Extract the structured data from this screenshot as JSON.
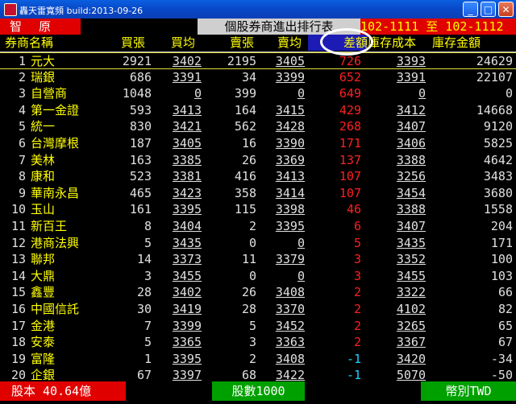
{
  "window": {
    "title": "轟天雷寬頻 build:2013-09-26",
    "min_label": "_",
    "max_label": "□",
    "close_label": "✕"
  },
  "header": {
    "broker_label": "智 原",
    "table_title": "個股券商進出排行表",
    "date_range": "102-1111 至 102-1112"
  },
  "columns": {
    "name": "券商名稱",
    "buy": "買張",
    "buy_avg": "買均",
    "sell": "賣張",
    "sell_avg": "賣均",
    "diff": "差額",
    "cost": "庫存成本",
    "amount": "庫存金額"
  },
  "rows": [
    {
      "no": "1",
      "name": "元大",
      "buy": "2921",
      "buy_avg": "3402",
      "sell": "2195",
      "sell_avg": "3405",
      "diff": "726",
      "cost": "3393",
      "amount": "24629"
    },
    {
      "no": "2",
      "name": "瑞銀",
      "buy": "686",
      "buy_avg": "3391",
      "sell": "34",
      "sell_avg": "3399",
      "diff": "652",
      "cost": "3391",
      "amount": "22107"
    },
    {
      "no": "3",
      "name": "自營商",
      "buy": "1048",
      "buy_avg": "0",
      "sell": "399",
      "sell_avg": "0",
      "diff": "649",
      "cost": "0",
      "amount": "0"
    },
    {
      "no": "4",
      "name": "第一金證",
      "buy": "593",
      "buy_avg": "3413",
      "sell": "164",
      "sell_avg": "3415",
      "diff": "429",
      "cost": "3412",
      "amount": "14668"
    },
    {
      "no": "5",
      "name": "統一",
      "buy": "830",
      "buy_avg": "3421",
      "sell": "562",
      "sell_avg": "3428",
      "diff": "268",
      "cost": "3407",
      "amount": "9120"
    },
    {
      "no": "6",
      "name": "台灣摩根",
      "buy": "187",
      "buy_avg": "3405",
      "sell": "16",
      "sell_avg": "3390",
      "diff": "171",
      "cost": "3406",
      "amount": "5825"
    },
    {
      "no": "7",
      "name": "美林",
      "buy": "163",
      "buy_avg": "3385",
      "sell": "26",
      "sell_avg": "3369",
      "diff": "137",
      "cost": "3388",
      "amount": "4642"
    },
    {
      "no": "8",
      "name": "康和",
      "buy": "523",
      "buy_avg": "3381",
      "sell": "416",
      "sell_avg": "3413",
      "diff": "107",
      "cost": "3256",
      "amount": "3483"
    },
    {
      "no": "9",
      "name": "華南永昌",
      "buy": "465",
      "buy_avg": "3423",
      "sell": "358",
      "sell_avg": "3414",
      "diff": "107",
      "cost": "3454",
      "amount": "3680"
    },
    {
      "no": "10",
      "name": "玉山",
      "buy": "161",
      "buy_avg": "3395",
      "sell": "115",
      "sell_avg": "3398",
      "diff": "46",
      "cost": "3388",
      "amount": "1558"
    },
    {
      "no": "11",
      "name": "新百王",
      "buy": "8",
      "buy_avg": "3404",
      "sell": "2",
      "sell_avg": "3395",
      "diff": "6",
      "cost": "3407",
      "amount": "204"
    },
    {
      "no": "12",
      "name": "港商法興",
      "buy": "5",
      "buy_avg": "3435",
      "sell": "0",
      "sell_avg": "0",
      "diff": "5",
      "cost": "3435",
      "amount": "171"
    },
    {
      "no": "13",
      "name": "聯邦",
      "buy": "14",
      "buy_avg": "3373",
      "sell": "11",
      "sell_avg": "3379",
      "diff": "3",
      "cost": "3352",
      "amount": "100"
    },
    {
      "no": "14",
      "name": "大鼎",
      "buy": "3",
      "buy_avg": "3455",
      "sell": "0",
      "sell_avg": "0",
      "diff": "3",
      "cost": "3455",
      "amount": "103"
    },
    {
      "no": "15",
      "name": "鑫豐",
      "buy": "28",
      "buy_avg": "3402",
      "sell": "26",
      "sell_avg": "3408",
      "diff": "2",
      "cost": "3322",
      "amount": "66"
    },
    {
      "no": "16",
      "name": "中國信託",
      "buy": "30",
      "buy_avg": "3419",
      "sell": "28",
      "sell_avg": "3370",
      "diff": "2",
      "cost": "4102",
      "amount": "82"
    },
    {
      "no": "17",
      "name": "金港",
      "buy": "7",
      "buy_avg": "3399",
      "sell": "5",
      "sell_avg": "3452",
      "diff": "2",
      "cost": "3265",
      "amount": "65"
    },
    {
      "no": "18",
      "name": "安泰",
      "buy": "5",
      "buy_avg": "3365",
      "sell": "3",
      "sell_avg": "3363",
      "diff": "2",
      "cost": "3367",
      "amount": "67"
    },
    {
      "no": "19",
      "name": "富隆",
      "buy": "1",
      "buy_avg": "3395",
      "sell": "2",
      "sell_avg": "3408",
      "diff": "-1",
      "cost": "3420",
      "amount": "-34"
    },
    {
      "no": "20",
      "name": "企銀",
      "buy": "67",
      "buy_avg": "3397",
      "sell": "68",
      "sell_avg": "3422",
      "diff": "-1",
      "cost": "5070",
      "amount": "-50"
    }
  ],
  "footer": {
    "capital": "股本 40.64億",
    "shares": "股數1000",
    "currency": "幣別TWD"
  },
  "colors": {
    "positive_diff": "#ff2020",
    "negative_diff": "#20d0ff",
    "name_text": "#ffff00"
  },
  "icons": [
    "app-icon",
    "minimize-icon",
    "maximize-icon",
    "close-icon"
  ]
}
